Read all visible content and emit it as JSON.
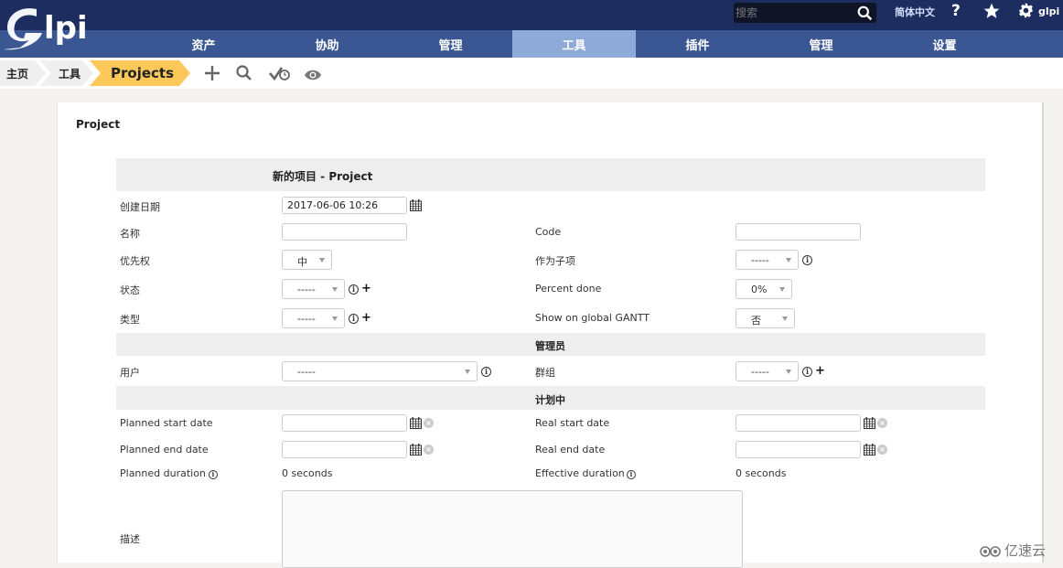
{
  "app": {
    "logo_text": "Glpi",
    "search_placeholder": "搜索",
    "language": "简体中文",
    "help_label": "?",
    "username": "glpi",
    "brand_color": "#1e2d60",
    "nav_color": "#3a5693",
    "active_nav_color": "#8eaad9",
    "breadcrumb_active_color": "#fbc859"
  },
  "nav": {
    "items": [
      {
        "label": "资产"
      },
      {
        "label": "协助"
      },
      {
        "label": "管理"
      },
      {
        "label": "工具",
        "active": true
      },
      {
        "label": "插件"
      },
      {
        "label": "管理"
      },
      {
        "label": "设置"
      }
    ]
  },
  "breadcrumb": {
    "items": [
      {
        "label": "主页"
      },
      {
        "label": "工具"
      },
      {
        "label": "Projects"
      }
    ],
    "actions": [
      "add-icon",
      "search-icon",
      "check-clock-icon",
      "eye-icon"
    ]
  },
  "page": {
    "title": "Project",
    "form_header": "新的项目 - Project",
    "sections": {
      "manager": "管理员",
      "planning": "计划中"
    },
    "fields": {
      "creation_date": {
        "label": "创建日期",
        "value": "2017-06-06 10:26"
      },
      "name": {
        "label": "名称",
        "value": ""
      },
      "code": {
        "label": "Code",
        "value": ""
      },
      "priority": {
        "label": "优先权",
        "value": "中"
      },
      "parent": {
        "label": "作为子项",
        "value": "-----"
      },
      "status": {
        "label": "状态",
        "value": "-----"
      },
      "percent_done": {
        "label": "Percent done",
        "value": "0%"
      },
      "type": {
        "label": "类型",
        "value": "-----"
      },
      "show_gantt": {
        "label": "Show on global GANTT",
        "value": "否"
      },
      "user": {
        "label": "用户",
        "value": "-----"
      },
      "group": {
        "label": "群组",
        "value": "-----"
      },
      "planned_start": {
        "label": "Planned start date",
        "value": ""
      },
      "real_start": {
        "label": "Real start date",
        "value": ""
      },
      "planned_end": {
        "label": "Planned end date",
        "value": ""
      },
      "real_end": {
        "label": "Real end date",
        "value": ""
      },
      "planned_duration": {
        "label": "Planned duration",
        "value": "0 seconds"
      },
      "effective_duration": {
        "label": "Effective duration",
        "value": "0 seconds"
      },
      "description": {
        "label": "描述",
        "value": ""
      }
    }
  },
  "watermark": "亿速云"
}
